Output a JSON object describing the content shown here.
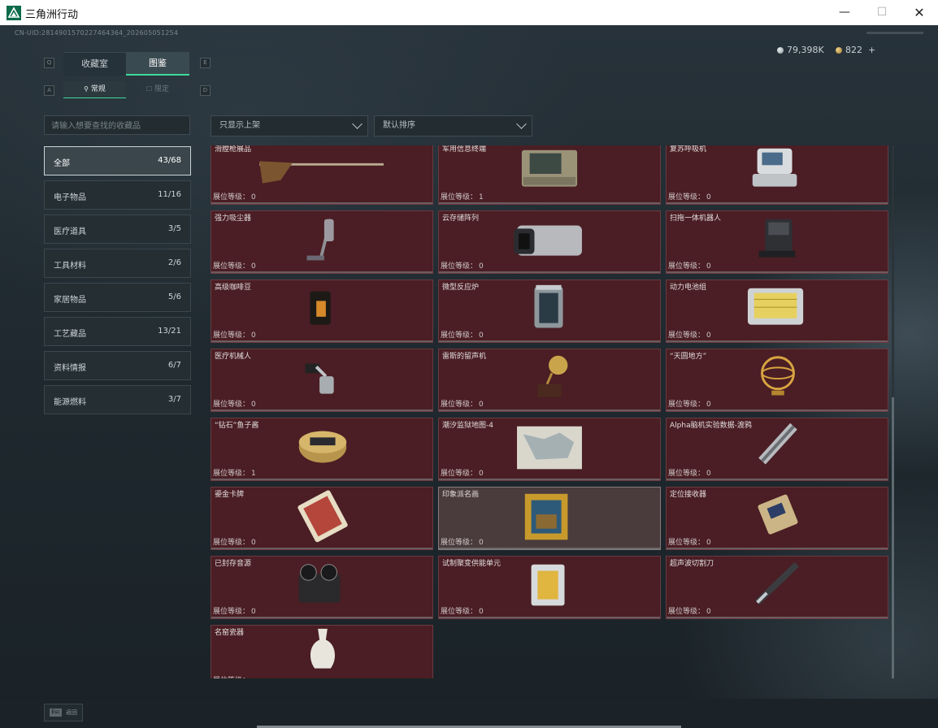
{
  "window": {
    "title": "三角洲行动",
    "minimize": "—",
    "maximize": "☐",
    "close": "✕"
  },
  "uid": "CN-UID:281490157022746436​4_202605051254",
  "currency": {
    "silver": "79,398K",
    "gold": "822",
    "plus": "+"
  },
  "key_hints": {
    "tab_left": "Q",
    "tab_right": "E",
    "sub_left": "A",
    "sub_right": "D"
  },
  "tabs": [
    {
      "label": "收藏室"
    },
    {
      "label": "图鉴"
    }
  ],
  "subtabs": [
    {
      "label": "常规"
    },
    {
      "label": "限定"
    }
  ],
  "search": {
    "placeholder": "请输入想要查找的收藏品"
  },
  "filters": {
    "shelf": "只显示上架",
    "sort": "默认排序"
  },
  "categories": [
    {
      "name": "全部",
      "count": "43/68"
    },
    {
      "name": "电子物品",
      "count": "11/16"
    },
    {
      "name": "医疗道具",
      "count": "3/5"
    },
    {
      "name": "工具材料",
      "count": "2/6"
    },
    {
      "name": "家居物品",
      "count": "5/6"
    },
    {
      "name": "工艺藏品",
      "count": "13/21"
    },
    {
      "name": "资料情报",
      "count": "6/7"
    },
    {
      "name": "能源燃料",
      "count": "3/7"
    }
  ],
  "level_label": "展位等级：",
  "items": [
    {
      "name": "滑膛枪展品",
      "level": "0"
    },
    {
      "name": "军用信息终端",
      "level": "1"
    },
    {
      "name": "复苏呼吸机",
      "level": "0"
    },
    {
      "name": "强力吸尘器",
      "level": "0"
    },
    {
      "name": "云存储阵列",
      "level": "0"
    },
    {
      "name": "扫拖一体机器人",
      "level": "0"
    },
    {
      "name": "高级咖啡豆",
      "level": "0"
    },
    {
      "name": "微型反应炉",
      "level": "0"
    },
    {
      "name": "动力电池组",
      "level": "0"
    },
    {
      "name": "医疗机械人",
      "level": "0"
    },
    {
      "name": "雷斯的留声机",
      "level": "0"
    },
    {
      "name": "“天圆地方”",
      "level": "0"
    },
    {
      "name": "“钻石”鱼子酱",
      "level": "1"
    },
    {
      "name": "潮汐监狱地图-4",
      "level": "0"
    },
    {
      "name": "Alpha脑机实验数据-渡鸦",
      "level": "0"
    },
    {
      "name": "鎏金卡牌",
      "level": "0"
    },
    {
      "name": "印象派名画",
      "level": "0"
    },
    {
      "name": "定位接收器",
      "level": "0"
    },
    {
      "name": "已封存音源",
      "level": "0"
    },
    {
      "name": "试制聚变供能单元",
      "level": "0"
    },
    {
      "name": "超声波切割刀",
      "level": "0"
    },
    {
      "name": "名窑瓷器",
      "level": ""
    }
  ],
  "bottom": {
    "esc_key": "Esc",
    "esc_label": "返回"
  },
  "colors": {
    "accent": "#3ed99a",
    "card_bg": "#4a1e24",
    "card_highlight": "#4a3b3d"
  }
}
